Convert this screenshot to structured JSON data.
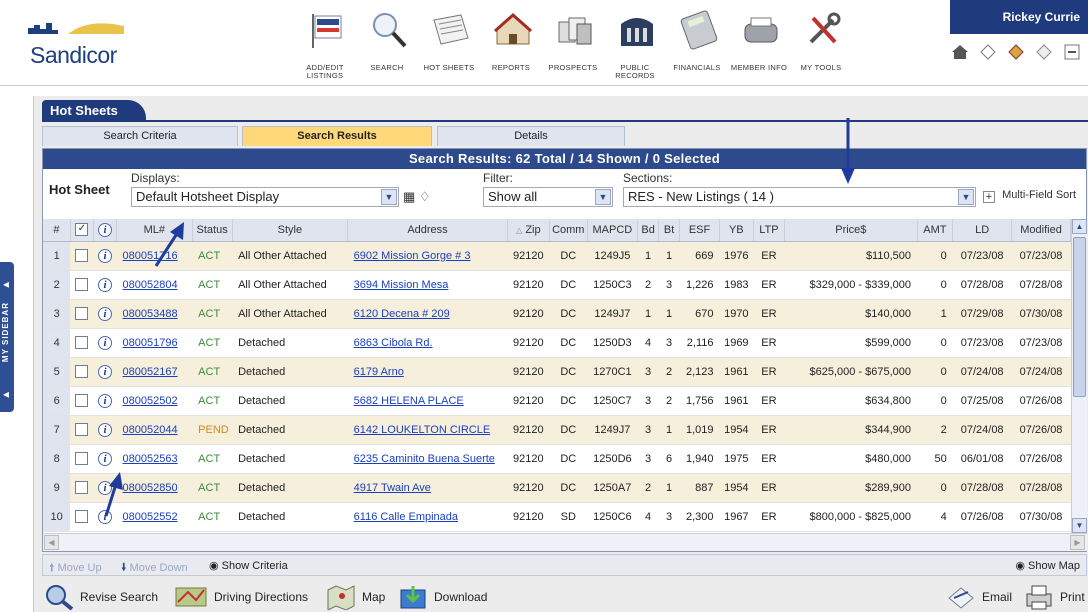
{
  "header": {
    "brand": "Sandicor",
    "user_name": "Rickey Currie",
    "nav": [
      {
        "label": "ADD/EDIT LISTINGS",
        "icon": "for-sale-sign-icon"
      },
      {
        "label": "SEARCH",
        "icon": "magnifier-icon"
      },
      {
        "label": "HOT SHEETS",
        "icon": "newspaper-icon"
      },
      {
        "label": "REPORTS",
        "icon": "house-report-icon"
      },
      {
        "label": "PROSPECTS",
        "icon": "prospects-icon"
      },
      {
        "label": "PUBLIC RECORDS",
        "icon": "public-records-icon"
      },
      {
        "label": "FINANCIALS",
        "icon": "calculator-icon"
      },
      {
        "label": "MEMBER INFO",
        "icon": "member-info-icon"
      },
      {
        "label": "MY TOOLS",
        "icon": "tools-icon"
      }
    ],
    "quick_icons": [
      "home-icon",
      "tag-icon",
      "ribbon-icon",
      "tag-outline-icon",
      "minimize-icon"
    ]
  },
  "sidebar": {
    "label": "MY SIDEBAR"
  },
  "page": {
    "section_tab": "Hot Sheets",
    "tabs": [
      {
        "label": "Search Criteria",
        "active": false
      },
      {
        "label": "Search Results",
        "active": true
      },
      {
        "label": "Details",
        "active": false
      }
    ]
  },
  "results": {
    "header": "Search Results: 62 Total / 14 Shown / 0 Selected",
    "controls": {
      "hotsheet_label": "Hot Sheet",
      "displays_label": "Displays:",
      "displays_value": "Default Hotsheet Display",
      "filter_label": "Filter:",
      "filter_value": "Show all",
      "sections_label": "Sections:",
      "sections_value": "RES - New Listings ( 14 )",
      "multisort_label": "Multi-Field Sort",
      "multisort_box": "+"
    },
    "columns": [
      "#",
      "",
      "",
      "ML#",
      "Status",
      "Style",
      "Address",
      "Zip",
      "Comm",
      "MAPCD",
      "Bd",
      "Bt",
      "ESF",
      "YB",
      "LTP",
      "Price$",
      "AMT",
      "LD",
      "Modified"
    ],
    "rows": [
      {
        "n": "1",
        "ml": "080051716",
        "status": "ACT",
        "style": "All Other Attached",
        "address": "6902 Mission Gorge # 3",
        "zip": "92120",
        "comm": "DC",
        "mapcd": "1249J5",
        "bd": "1",
        "bt": "1",
        "esf": "669",
        "yb": "1976",
        "ltp": "ER",
        "price": "$110,500",
        "amt": "0",
        "ld": "07/23/08",
        "mod": "07/23/08"
      },
      {
        "n": "2",
        "ml": "080052804",
        "status": "ACT",
        "style": "All Other Attached",
        "address": "3694 Mission Mesa",
        "zip": "92120",
        "comm": "DC",
        "mapcd": "1250C3",
        "bd": "2",
        "bt": "3",
        "esf": "1,226",
        "yb": "1983",
        "ltp": "ER",
        "price": "$329,000 - $339,000",
        "amt": "0",
        "ld": "07/28/08",
        "mod": "07/28/08"
      },
      {
        "n": "3",
        "ml": "080053488",
        "status": "ACT",
        "style": "All Other Attached",
        "address": "6120 Decena # 209",
        "zip": "92120",
        "comm": "DC",
        "mapcd": "1249J7",
        "bd": "1",
        "bt": "1",
        "esf": "670",
        "yb": "1970",
        "ltp": "ER",
        "price": "$140,000",
        "amt": "1",
        "ld": "07/29/08",
        "mod": "07/30/08"
      },
      {
        "n": "4",
        "ml": "080051796",
        "status": "ACT",
        "style": "Detached",
        "address": "6863 Cibola Rd.",
        "zip": "92120",
        "comm": "DC",
        "mapcd": "1250D3",
        "bd": "4",
        "bt": "3",
        "esf": "2,116",
        "yb": "1969",
        "ltp": "ER",
        "price": "$599,000",
        "amt": "0",
        "ld": "07/23/08",
        "mod": "07/23/08"
      },
      {
        "n": "5",
        "ml": "080052167",
        "status": "ACT",
        "style": "Detached",
        "address": "6179 Arno",
        "zip": "92120",
        "comm": "DC",
        "mapcd": "1270C1",
        "bd": "3",
        "bt": "2",
        "esf": "2,123",
        "yb": "1961",
        "ltp": "ER",
        "price": "$625,000 - $675,000",
        "amt": "0",
        "ld": "07/24/08",
        "mod": "07/24/08"
      },
      {
        "n": "6",
        "ml": "080052502",
        "status": "ACT",
        "style": "Detached",
        "address": "5682 HELENA PLACE",
        "zip": "92120",
        "comm": "DC",
        "mapcd": "1250C7",
        "bd": "3",
        "bt": "2",
        "esf": "1,756",
        "yb": "1961",
        "ltp": "ER",
        "price": "$634,800",
        "amt": "0",
        "ld": "07/25/08",
        "mod": "07/26/08"
      },
      {
        "n": "7",
        "ml": "080052044",
        "status": "PEND",
        "style": "Detached",
        "address": "6142 LOUKELTON CIRCLE",
        "zip": "92120",
        "comm": "DC",
        "mapcd": "1249J7",
        "bd": "3",
        "bt": "1",
        "esf": "1,019",
        "yb": "1954",
        "ltp": "ER",
        "price": "$344,900",
        "amt": "2",
        "ld": "07/24/08",
        "mod": "07/26/08"
      },
      {
        "n": "8",
        "ml": "080052563",
        "status": "ACT",
        "style": "Detached",
        "address": "6235 Caminito Buena Suerte",
        "zip": "92120",
        "comm": "DC",
        "mapcd": "1250D6",
        "bd": "3",
        "bt": "6",
        "esf": "1,940",
        "yb": "1975",
        "ltp": "ER",
        "price": "$480,000",
        "amt": "50",
        "ld": "06/01/08",
        "mod": "07/26/08"
      },
      {
        "n": "9",
        "ml": "080052850",
        "status": "ACT",
        "style": "Detached",
        "address": "4917 Twain Ave",
        "zip": "92120",
        "comm": "DC",
        "mapcd": "1250A7",
        "bd": "2",
        "bt": "1",
        "esf": "887",
        "yb": "1954",
        "ltp": "ER",
        "price": "$289,900",
        "amt": "0",
        "ld": "07/28/08",
        "mod": "07/28/08"
      },
      {
        "n": "10",
        "ml": "080052552",
        "status": "ACT",
        "style": "Detached",
        "address": "6116 Calle Empinada",
        "zip": "92120",
        "comm": "SD",
        "mapcd": "1250C6",
        "bd": "4",
        "bt": "3",
        "esf": "2,300",
        "yb": "1967",
        "ltp": "ER",
        "price": "$800,000 - $825,000",
        "amt": "4",
        "ld": "07/26/08",
        "mod": "07/30/08"
      }
    ]
  },
  "toolbar": {
    "move_up": "Move Up",
    "move_down": "Move Down",
    "show_criteria": "Show Criteria",
    "show_map": "Show Map"
  },
  "actions": {
    "revise_search": "Revise Search",
    "driving_directions": "Driving Directions",
    "map": "Map",
    "download": "Download",
    "email": "Email",
    "print": "Print"
  },
  "colors": {
    "brand_navy": "#1f3b7d",
    "results_header": "#2c4a8c",
    "active_tab": "#ffd979",
    "status_act": "#3f8a3f",
    "status_pend": "#d28a18",
    "link": "#1a3fbf",
    "row_alt": "#f6efdc"
  }
}
